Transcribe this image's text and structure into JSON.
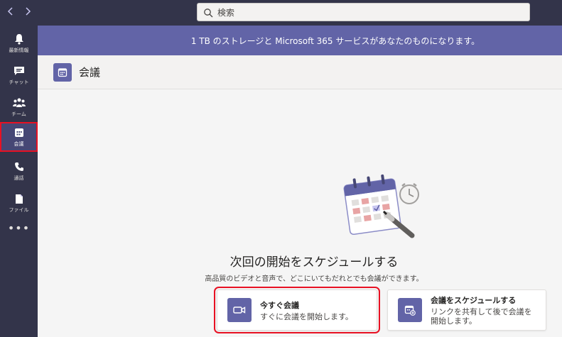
{
  "search": {
    "placeholder": "検索"
  },
  "rail": {
    "items": [
      {
        "label": "最新情報",
        "icon": "bell-icon"
      },
      {
        "label": "チャット",
        "icon": "chat-icon"
      },
      {
        "label": "チーム",
        "icon": "teams-icon"
      },
      {
        "label": "会議",
        "icon": "calendar-icon",
        "active": true
      },
      {
        "label": "通話",
        "icon": "phone-icon"
      },
      {
        "label": "ファイル",
        "icon": "file-icon"
      }
    ],
    "more": "•••"
  },
  "banner": {
    "text": "1 TB のストレージと Microsoft 365 サービスがあなたのものになります。"
  },
  "header": {
    "title": "会議"
  },
  "main": {
    "heading": "次回の開始をスケジュールする",
    "subtext": "高品質のビデオと音声で、どこにいてもだれとでも会議ができます。"
  },
  "cards": [
    {
      "title": "今すぐ会議",
      "desc": "すぐに会議を開始します。",
      "icon": "video-camera-icon"
    },
    {
      "title": "会議をスケジュールする",
      "desc_line1": "リンクを共有して後で会議を",
      "desc_line2": "開始します。",
      "icon": "calendar-add-icon"
    }
  ],
  "colors": {
    "brand": "#6264a7",
    "rail": "#33344a",
    "highlight": "#e81123"
  }
}
